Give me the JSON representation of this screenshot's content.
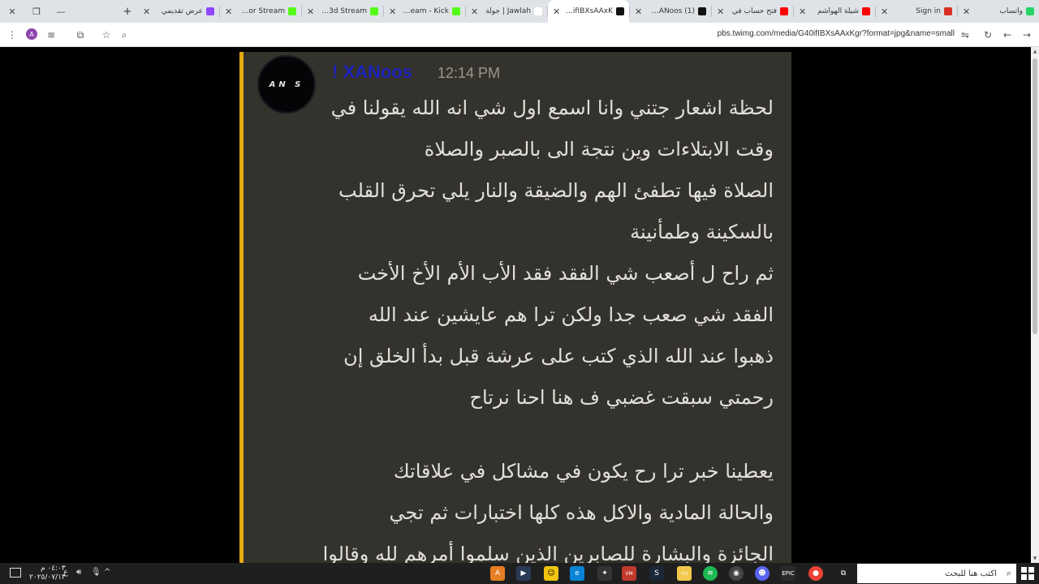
{
  "browser": {
    "tabs": [
      {
        "title": "واتساب",
        "favicon_color": "#25d366",
        "active": false
      },
      {
        "title": "Sign in",
        "favicon_color": "#d93025",
        "active": false
      },
      {
        "title": "شيلة الهواشم",
        "favicon_color": "#ff0000",
        "active": false
      },
      {
        "title": "فتح حساب في",
        "favicon_color": "#ff0000",
        "active": false
      },
      {
        "title": "(1) XANoos (@",
        "favicon_color": "#111111",
        "active": false
      },
      {
        "title": "G40ifIBXsAAxK",
        "favicon_color": "#111111",
        "active": true
      },
      {
        "title": "Jawlah | جولة",
        "favicon_color": "#ffffff",
        "active": false
      },
      {
        "title": "Stream - Kick",
        "favicon_color": "#53fc18",
        "active": false
      },
      {
        "title": "zR3d Stream -",
        "favicon_color": "#53fc18",
        "active": false
      },
      {
        "title": "Abo7or Stream",
        "favicon_color": "#53fc18",
        "active": false
      },
      {
        "title": "عرض تقديمي",
        "favicon_color": "#9146ff",
        "active": false
      }
    ],
    "url": "pbs.twimg.com/media/G40ifIBXsAAxKgr?format=jpg&name=small",
    "profile_initial": "A"
  },
  "message": {
    "avatar_text": "AN S",
    "username": "! XANoos",
    "time": "12:14 PM",
    "lines": [
      "لحظة اشعار جتني وانا اسمع  اول شي انه الله يقولنا في",
      "وقت   الابتلاءات  وين نتجة الى بالصبر والصلاة",
      "الصلاة فيها تطفئ الهم والضيقة والنار يلي تحرق القلب",
      "بالسكينة وطمأنينة",
      "ثم راح ل أصعب شي الفقد فقد الأب الأم الأخ الأخت",
      "الفقد شي صعب جدا ولكن ترا هم عايشين عند الله",
      "ذهبوا عند الله الذي كتب على عرشة قبل بدأ الخلق إن",
      "رحمتي سبقت غضبي ف هنا احنا نرتاح",
      "",
      "يعطينا خبر ترا رح يكون في مشاكل في علاقاتك",
      "والحالة المادية والاكل هذه كلها اختبارات ثم تجي",
      "الجائزة والبشارة للصابرين الذين سلموا أمرهم لله وقالوا"
    ]
  },
  "taskbar": {
    "search_placeholder": "اكتب هنا للبحث",
    "clock_time": "٠٤:٠٣ م",
    "clock_date": "٢٠٢٥/٠٧/١٣",
    "language": "ع",
    "apps": [
      {
        "name": "file-explorer",
        "color": "#f2c94c"
      },
      {
        "name": "chrome",
        "color": "#ea4335"
      },
      {
        "name": "task-view",
        "color": "#444444"
      }
    ]
  }
}
